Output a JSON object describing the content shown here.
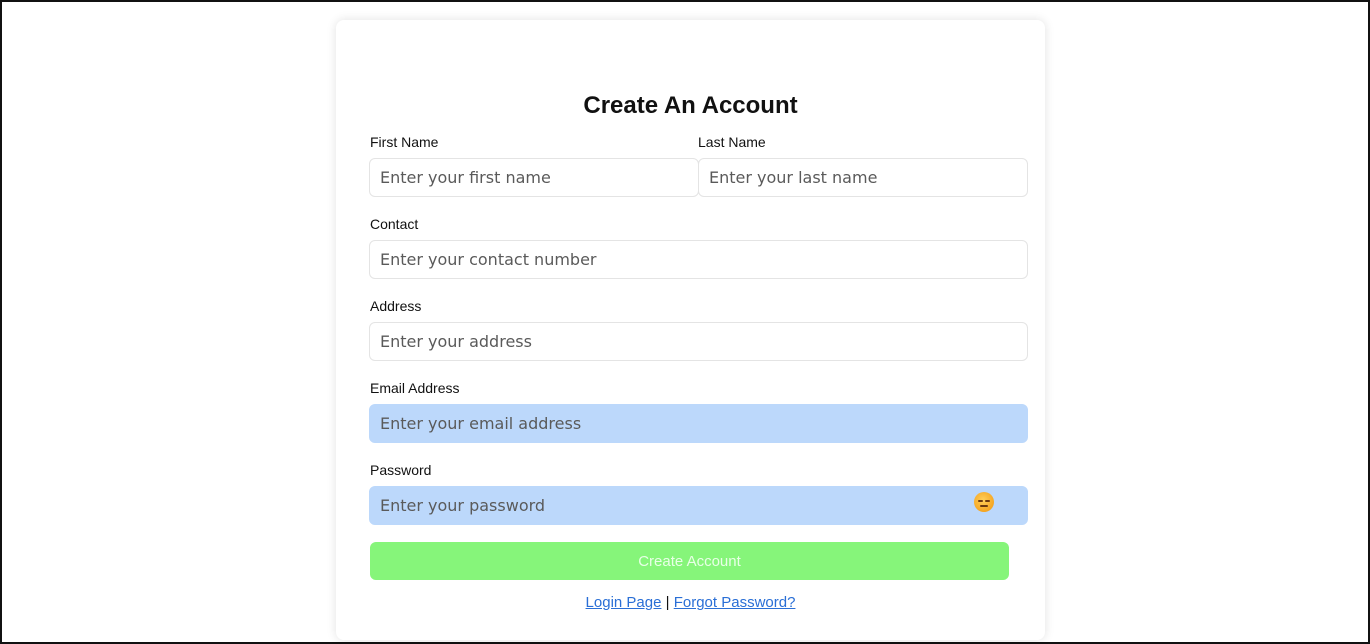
{
  "form": {
    "title": "Create An Account",
    "first_name": {
      "label": "First Name",
      "placeholder": "Enter your first name",
      "value": ""
    },
    "last_name": {
      "label": "Last Name",
      "placeholder": "Enter your last name",
      "value": ""
    },
    "contact": {
      "label": "Contact",
      "placeholder": "Enter your contact number",
      "value": ""
    },
    "address": {
      "label": "Address",
      "placeholder": "Enter your address",
      "value": ""
    },
    "email": {
      "label": "Email Address",
      "placeholder": "Enter your email address",
      "value": ""
    },
    "password": {
      "label": "Password",
      "placeholder": "Enter your password",
      "value": "",
      "toggle_icon": "expressionless-face-icon"
    },
    "submit_label": "Create Account",
    "links": {
      "login": "Login Page",
      "separator": "|",
      "forgot": "Forgot Password?"
    }
  },
  "colors": {
    "autofill_bg": "#bcd8fb",
    "submit_bg": "#86f57a",
    "link": "#2a6fd6"
  }
}
